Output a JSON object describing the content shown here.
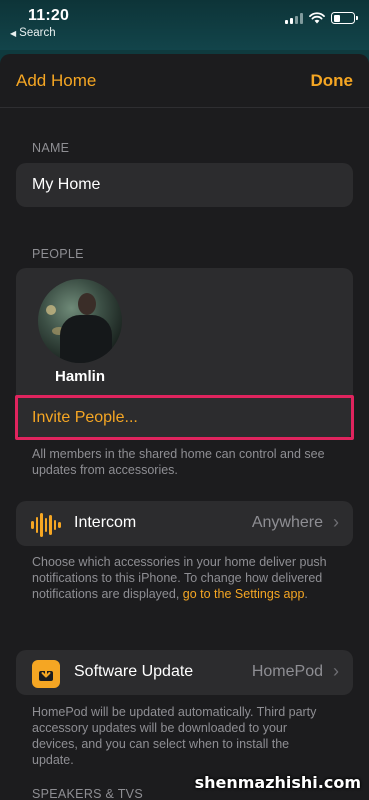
{
  "status_bar": {
    "time": "11:20",
    "back_label": "Search",
    "back_icon": "back-triangle-icon",
    "signal_icon": "cellular-signal-icon",
    "wifi_icon": "wifi-icon",
    "battery_icon": "battery-icon"
  },
  "nav": {
    "title_left": "Add Home",
    "done_label": "Done"
  },
  "name_section": {
    "header": "NAME",
    "value": "My Home"
  },
  "people_section": {
    "header": "PEOPLE",
    "person_name": "Hamlin",
    "invite_label": "Invite People...",
    "footer": "All members in the shared home can control and see updates from accessories."
  },
  "intercom": {
    "label": "Intercom",
    "value": "Anywhere",
    "footer_text": "Choose which accessories in your home deliver push notifications to this iPhone. To change how delivered notifications are displayed, ",
    "footer_link": "go to the Settings app",
    "footer_end": "."
  },
  "software_update": {
    "label": "Software Update",
    "value": "HomePod",
    "footer": "HomePod will be updated automatically. Third party accessory updates will be downloaded to your devices, and you can select when to install the update."
  },
  "speakers_section": {
    "header": "SPEAKERS & TVS"
  },
  "watermark": "shenmazhishi.com",
  "colors": {
    "accent": "#f5a623",
    "highlight": "#e0245e",
    "background": "#1c1c1e",
    "card": "#2c2c2e"
  }
}
